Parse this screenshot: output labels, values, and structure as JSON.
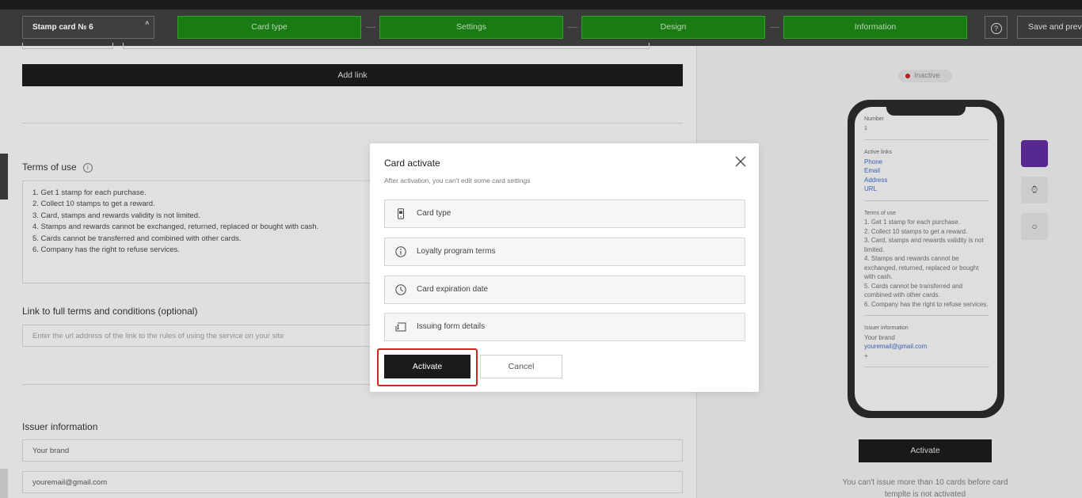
{
  "header": {
    "card_name": "Stamp card № 6",
    "steps": [
      "Card type",
      "Settings",
      "Design",
      "Information"
    ],
    "help_label": "?",
    "save_label": "Save and previ"
  },
  "form": {
    "add_link_label": "Add link",
    "terms_title": "Terms of use",
    "terms_lines": [
      "1. Get 1 stamp for each purchase.",
      "2. Collect 10 stamps to get a reward.",
      "3. Card, stamps and rewards validity is not limited.",
      "4. Stamps and rewards cannot be exchanged, returned, replaced or bought with cash.",
      "5. Cards cannot be transferred and combined with other cards.",
      "6. Company has the right to refuse services."
    ],
    "link_title": "Link to full terms and conditions (optional)",
    "link_placeholder": "Enter the url address of the link to the rules of using the service on your site",
    "issuer_title": "Issuer information",
    "brand_value": "Your brand",
    "email_value": "youremail@gmail.com"
  },
  "preview": {
    "status": "Inactive",
    "screen": {
      "number_label": "Number",
      "number_value": "1",
      "active_links_label": "Active links",
      "links": [
        "Phone",
        "Email",
        "Address",
        "URL"
      ],
      "terms_label": "Terms of use",
      "terms_text": "1. Get 1 stamp for each purchase.\n2. Collect 10 stamps to get a reward.\n3. Card, stamps and rewards validity is not limited.\n4. Stamps and rewards cannot be exchanged, returned, replaced or bought with cash.\n5. Cards cannot be transferred and combined with other cards.\n6. Company has the right to refuse services.",
      "issuer_label": "Issuer information",
      "issuer_brand": "Your brand",
      "issuer_email": "youremail@gmail.com",
      "issuer_extra": "+"
    },
    "activate_label": "Activate",
    "note": "You can't issue more than 10 cards before card templte is not activated"
  },
  "modal": {
    "title": "Card activate",
    "subtitle": "After activation, you can't edit some card settings",
    "items": [
      {
        "label": "Card type",
        "icon": "phone-card-icon"
      },
      {
        "label": "Loyalty program terms",
        "icon": "info-circle-icon"
      },
      {
        "label": "Card expiration date",
        "icon": "clock-icon"
      },
      {
        "label": "Issuing form details",
        "icon": "form-icon"
      }
    ],
    "activate_label": "Activate",
    "cancel_label": "Cancel"
  },
  "colors": {
    "step_green": "#1a7a14",
    "highlight_red": "#d6231d",
    "status_red": "#c0201c",
    "wallet_purple": "#5c2b99"
  }
}
